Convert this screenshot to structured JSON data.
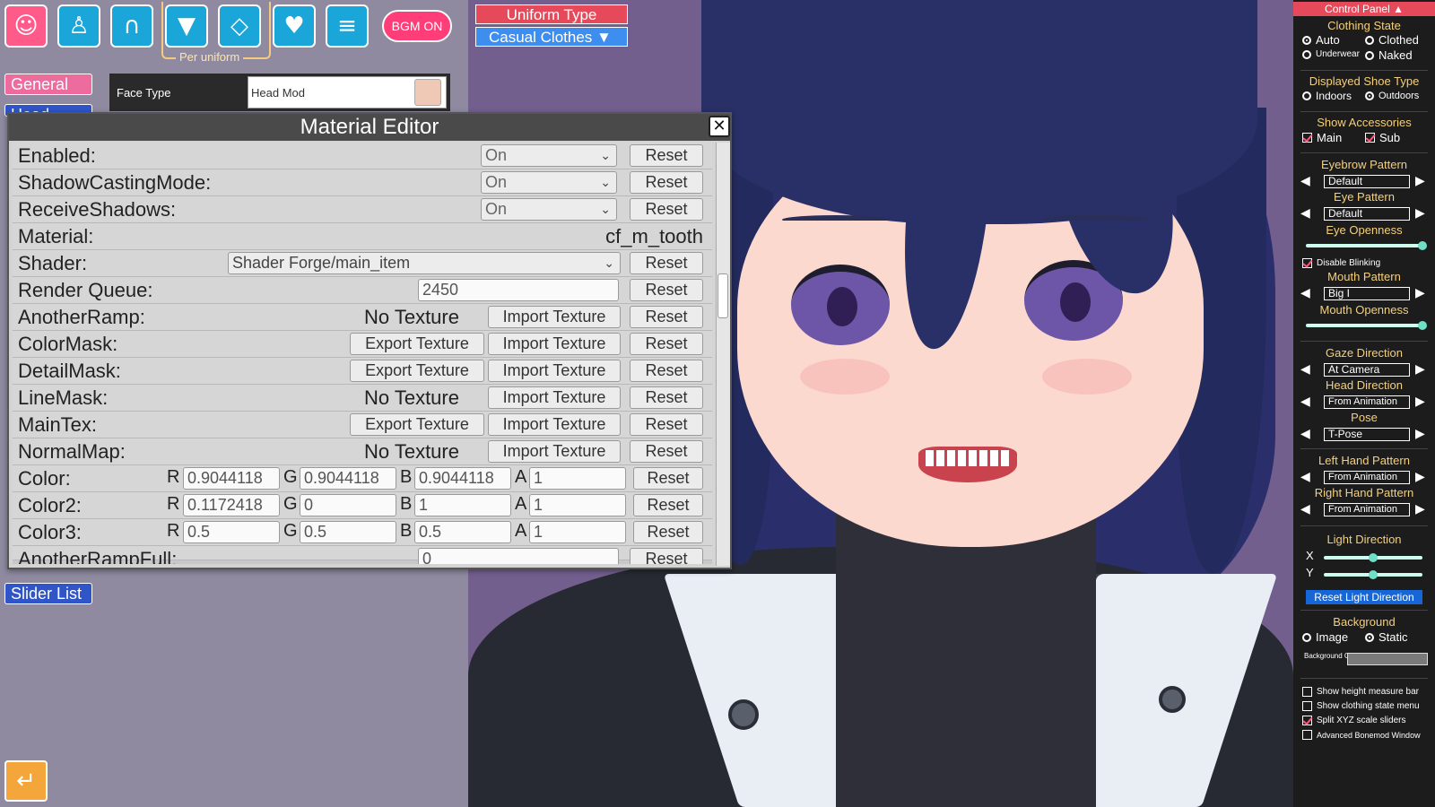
{
  "toolbar": {
    "bgm_label": "BGM ON",
    "per_uniform_label": "Per uniform",
    "icons": [
      "face-icon",
      "body-icon",
      "hair-icon",
      "clothing-icon",
      "accessory-icon",
      "favorite-icon",
      "document-icon"
    ]
  },
  "uniform": {
    "title": "Uniform Type",
    "value": "Casual Clothes ▼"
  },
  "tabs": {
    "general": "General",
    "head": "Head",
    "slider_list": "Slider List"
  },
  "face_type": {
    "label": "Face Type",
    "value": "Head Mod"
  },
  "editor": {
    "title": "Material Editor",
    "close": "✕",
    "reset": "Reset",
    "import": "Import Texture",
    "export": "Export Texture",
    "no_texture": "No Texture",
    "rows": {
      "enabled": {
        "label": "Enabled:",
        "value": "On"
      },
      "shadow": {
        "label": "ShadowCastingMode:",
        "value": "On"
      },
      "receive": {
        "label": "ReceiveShadows:",
        "value": "On"
      },
      "material": {
        "label": "Material:",
        "value": "cf_m_tooth"
      },
      "shader": {
        "label": "Shader:",
        "value": "Shader Forge/main_item"
      },
      "queue": {
        "label": "Render Queue:",
        "value": "2450"
      },
      "anotherramp": {
        "label": "AnotherRamp:"
      },
      "colormask": {
        "label": "ColorMask:"
      },
      "detailmask": {
        "label": "DetailMask:"
      },
      "linemask": {
        "label": "LineMask:"
      },
      "maintex": {
        "label": "MainTex:"
      },
      "normalmap": {
        "label": "NormalMap:"
      },
      "color": {
        "label": "Color:",
        "r": "0.9044118",
        "g": "0.9044118",
        "b": "0.9044118",
        "a": "1"
      },
      "color2": {
        "label": "Color2:",
        "r": "0.1172418",
        "g": "0",
        "b": "1",
        "a": "1"
      },
      "color3": {
        "label": "Color3:",
        "r": "0.5",
        "g": "0.5",
        "b": "0.5",
        "a": "1"
      },
      "anotherfull": {
        "label": "AnotherRampFull:",
        "value": "0"
      }
    },
    "channels": {
      "r": "R",
      "g": "G",
      "b": "B",
      "a": "A"
    }
  },
  "control_panel": {
    "title": "Control Panel ▲",
    "clothing_state": "Clothing State",
    "auto": "Auto",
    "clothed": "Clothed",
    "underwear": "Underwear",
    "naked": "Naked",
    "shoe_type": "Displayed Shoe Type",
    "indoors": "Indoors",
    "outdoors": "Outdoors",
    "show_accessories": "Show Accessories",
    "main": "Main",
    "sub": "Sub",
    "eyebrow_pattern": "Eyebrow Pattern",
    "eyebrow_value": "Default",
    "eye_pattern": "Eye Pattern",
    "eye_value": "Default",
    "eye_openness": "Eye Openness",
    "eye_openness_level": 1.0,
    "disable_blinking": "Disable Blinking",
    "mouth_pattern": "Mouth Pattern",
    "mouth_value": "Big I",
    "mouth_openness": "Mouth Openness",
    "mouth_openness_level": 1.0,
    "gaze_direction": "Gaze Direction",
    "gaze_value": "At Camera",
    "head_direction": "Head Direction",
    "head_value": "From Animation",
    "pose": "Pose",
    "pose_value": "T-Pose",
    "left_hand": "Left Hand Pattern",
    "left_hand_value": "From Animation",
    "right_hand": "Right Hand Pattern",
    "right_hand_value": "From Animation",
    "light_direction": "Light Direction",
    "x": "X",
    "y": "Y",
    "light_x_level": 0.5,
    "light_y_level": 0.5,
    "reset_light": "Reset Light Direction",
    "background": "Background",
    "image": "Image",
    "static": "Static",
    "bg_color_label": "Background Color",
    "show_height": "Show height measure bar",
    "show_clothing_menu": "Show clothing state menu",
    "split_xyz": "Split XYZ scale sliders",
    "advanced_bonemod": "Advanced Bonemod Window"
  },
  "colors": {
    "accent_pink": "#ee6b9e",
    "accent_blue": "#2f55c9",
    "panel_red": "#e64a5a"
  }
}
